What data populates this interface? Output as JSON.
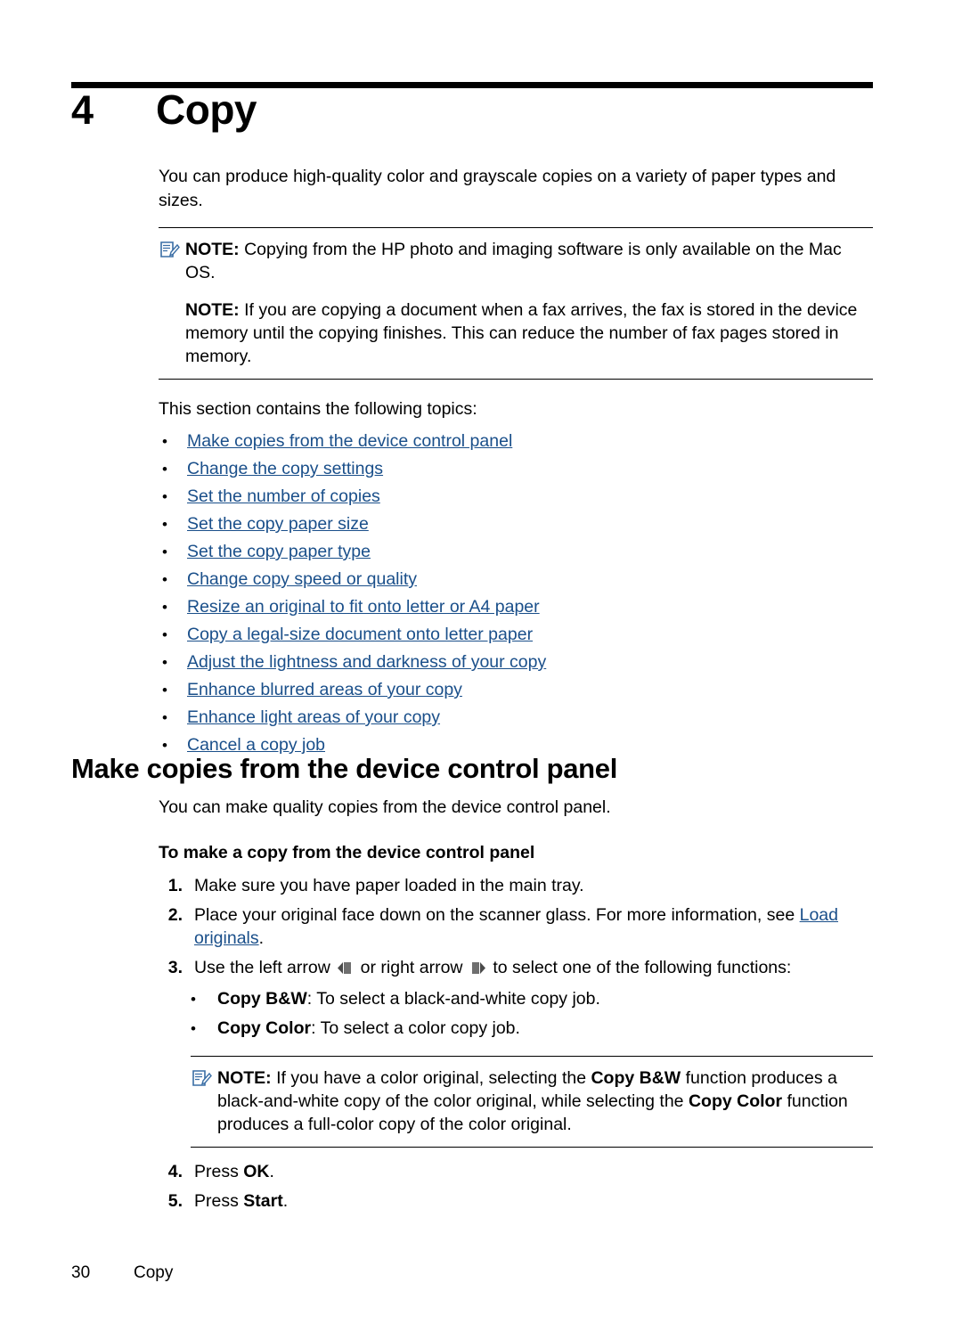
{
  "chapter": {
    "number": "4",
    "title": "Copy"
  },
  "intro": {
    "paragraph": "You can produce high-quality color and grayscale copies on a variety of paper types and sizes.",
    "note1_label": "NOTE:",
    "note1_text": "Copying from the HP photo and imaging software is only available on the Mac OS.",
    "note2_label": "NOTE:",
    "note2_text": "If you are copying a document when a fax arrives, the fax is stored in the device memory until the copying finishes. This can reduce the number of fax pages stored in memory.",
    "topics_intro": "This section contains the following topics:",
    "bullet": "•"
  },
  "topics": [
    {
      "label": "Make copies from the device control panel"
    },
    {
      "label": "Change the copy settings"
    },
    {
      "label": "Set the number of copies"
    },
    {
      "label": "Set the copy paper size"
    },
    {
      "label": "Set the copy paper type"
    },
    {
      "label": "Change copy speed or quality"
    },
    {
      "label": "Resize an original to fit onto letter or A4 paper"
    },
    {
      "label": "Copy a legal-size document onto letter paper"
    },
    {
      "label": "Adjust the lightness and darkness of your copy"
    },
    {
      "label": "Enhance blurred areas of your copy"
    },
    {
      "label": "Enhance light areas of your copy"
    },
    {
      "label": "Cancel a copy job"
    }
  ],
  "section": {
    "heading": "Make copies from the device control panel",
    "intro": "You can make quality copies from the device control panel.",
    "procedure_title": "To make a copy from the device control panel",
    "steps": [
      {
        "num": "1.",
        "text": "Make sure you have paper loaded in the main tray."
      },
      {
        "num": "2.",
        "text_before": "Place your original face down on the scanner glass. For more information, see ",
        "link": "Load originals",
        "text_after": "."
      },
      {
        "num": "3.",
        "text_before": "Use the left arrow ",
        "text_mid": " or right arrow ",
        "text_after": " to select one of the following functions:"
      },
      {
        "num": "4.",
        "text_before": "Press ",
        "bold": "OK",
        "text_after": "."
      },
      {
        "num": "5.",
        "text_before": "Press ",
        "bold": "Start",
        "text_after": "."
      }
    ],
    "substeps": [
      {
        "bold": "Copy B&W",
        "text": ": To select a black-and-white copy job."
      },
      {
        "bold": "Copy Color",
        "text": ": To select a color copy job."
      }
    ],
    "note_label": "NOTE:",
    "note_p1a": "If you have a color original, selecting the ",
    "note_p1b": "Copy B&W",
    "note_p1c": " function produces a black-and-white copy of the color original, while selecting the ",
    "note_p1d": "Copy",
    "note_p2a": "Color",
    "note_p2b": " function produces a full-color copy of the color original."
  },
  "footer": {
    "page_number": "30",
    "chapter_label": "Copy"
  },
  "colors": {
    "link": "#1a4f8a",
    "rule": "#000000",
    "note_icon": "#3a6ea5"
  }
}
